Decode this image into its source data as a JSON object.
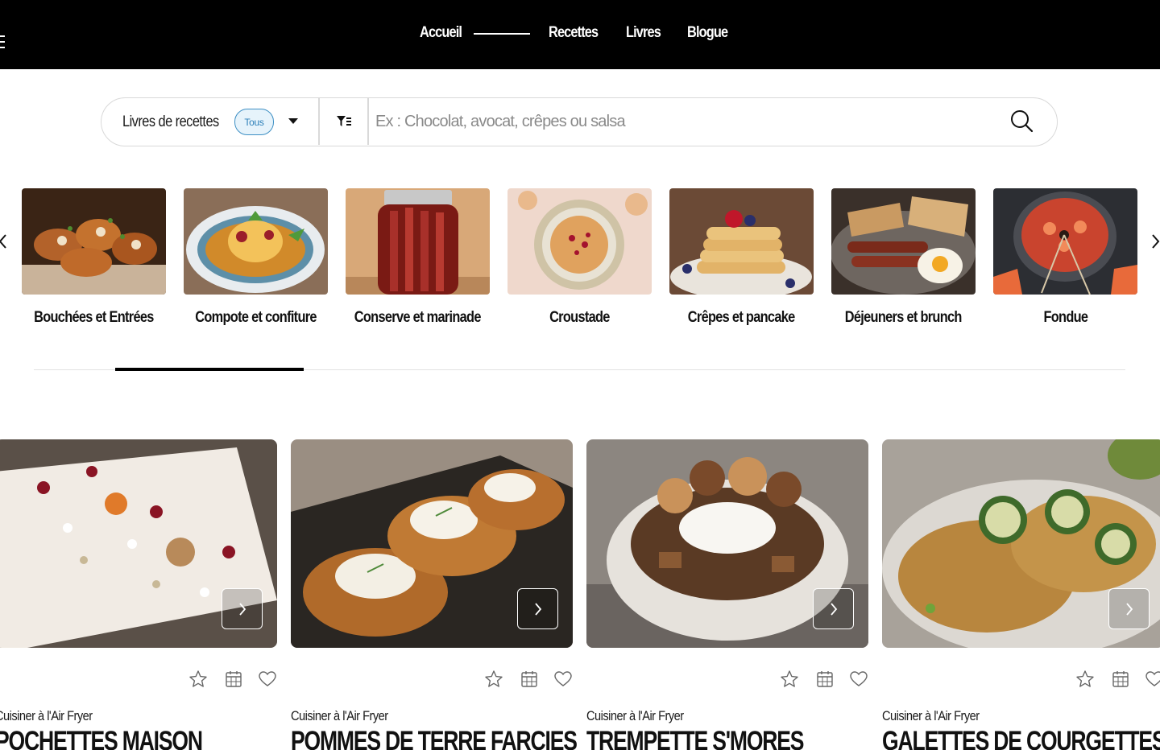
{
  "nav": {
    "links": [
      "Accueil",
      "Recettes",
      "Livres",
      "Blogue"
    ]
  },
  "search": {
    "cookbook_label": "Livres de recettes",
    "badge": "Tous",
    "placeholder": "Ex : Chocolat, avocat, crêpes ou salsa"
  },
  "categories": [
    {
      "label": "Bouchées et Entrées",
      "image": "stuffed-chicken-rolls"
    },
    {
      "label": "Compote et confiture",
      "image": "fruit-compote-plate"
    },
    {
      "label": "Conserve et marinade",
      "image": "rhubarb-pickle-jar"
    },
    {
      "label": "Croustade",
      "image": "berry-crumble-dish"
    },
    {
      "label": "Crêpes et pancake",
      "image": "pancake-stack-berries"
    },
    {
      "label": "Déjeuners et brunch",
      "image": "sausage-egg-toast-plate"
    },
    {
      "label": "Fondue",
      "image": "seafood-fondue-pot"
    }
  ],
  "carousel_progress": 0.17,
  "recipes": [
    {
      "book": "Cuisiner à l'Air Fryer",
      "title": "POCHETTES MAISON",
      "image": "decorated-pastry-log"
    },
    {
      "book": "Cuisiner à l'Air Fryer",
      "title": "POMMES DE TERRE FARCIES",
      "image": "stuffed-baked-potatoes"
    },
    {
      "book": "Cuisiner à l'Air Fryer",
      "title": "TREMPETTE S'MORES",
      "image": "smores-dip-bowl"
    },
    {
      "book": "Cuisiner à l'Air Fryer",
      "title": "GALETTES DE COURGETTES ET",
      "image": "zucchini-fritters-plate"
    }
  ],
  "card_icons": [
    "star-icon",
    "calendar-icon",
    "heart-icon"
  ],
  "colors": {
    "header_bg": "#000000",
    "badge_border": "#3d8fc4",
    "badge_bg": "#e6f3fb",
    "text": "#111111"
  }
}
